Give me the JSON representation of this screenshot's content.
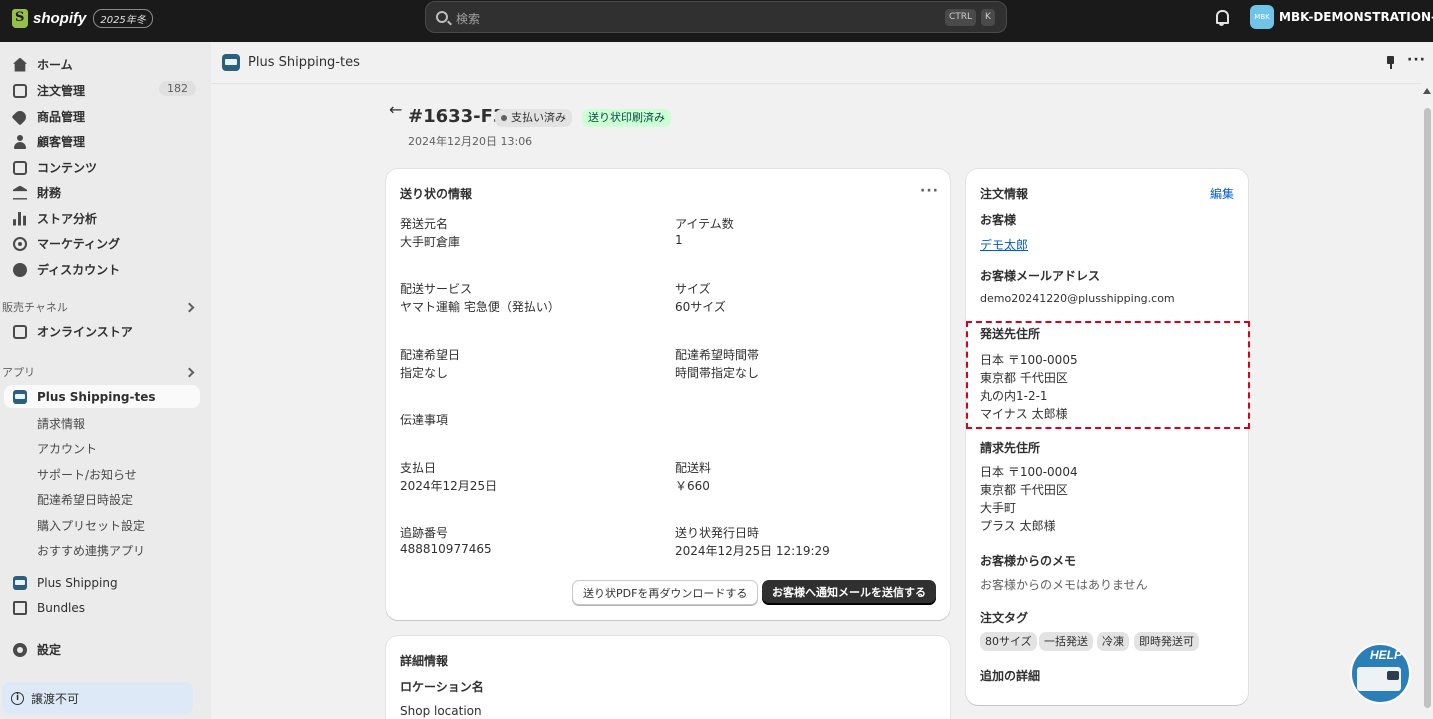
{
  "topbar": {
    "brand": "shopify",
    "edition_badge": "2025年冬",
    "search_placeholder": "検索",
    "shortcut_keys": [
      "CTRL",
      "K"
    ],
    "store_avatar": "MBK",
    "store_name": "MBK-DEMONSTRATION-..."
  },
  "sidebar": {
    "nav": [
      {
        "label": "ホーム",
        "icon": "home-icon"
      },
      {
        "label": "注文管理",
        "icon": "orders-icon",
        "count": "182"
      },
      {
        "label": "商品管理",
        "icon": "tag-icon"
      },
      {
        "label": "顧客管理",
        "icon": "person-icon"
      },
      {
        "label": "コンテンツ",
        "icon": "content-icon"
      },
      {
        "label": "財務",
        "icon": "bank-icon"
      },
      {
        "label": "ストア分析",
        "icon": "bar-chart-icon"
      },
      {
        "label": "マーケティング",
        "icon": "target-icon"
      },
      {
        "label": "ディスカウント",
        "icon": "discount-icon"
      }
    ],
    "sales_channels_header": "販売チャネル",
    "online_store": "オンラインストア",
    "apps_header": "アプリ",
    "active_app": "Plus Shipping-tes",
    "app_subitems": [
      "請求情報",
      "アカウント",
      "サポート/お知らせ",
      "配達希望日時設定",
      "購入プリセット設定",
      "おすすめ連携アプリ"
    ],
    "other_apps": [
      "Plus Shipping",
      "Bundles"
    ],
    "settings": "設定",
    "non_transferable": "譲渡不可"
  },
  "app_header": {
    "title": "Plus Shipping-tes"
  },
  "order": {
    "number": "#1633-F3",
    "payment_badge": "支払い済み",
    "label_badge": "送り状印刷済み",
    "date": "2024年12月20日 13:06"
  },
  "invoice_card": {
    "title": "送り状の情報",
    "fields": {
      "origin_label": "発送元名",
      "origin_value": "大手町倉庫",
      "items_label": "アイテム数",
      "items_value": "1",
      "service_label": "配送サービス",
      "service_value": "ヤマト運輸 宅急便（発払い）",
      "size_label": "サイズ",
      "size_value": "60サイズ",
      "date_label": "配達希望日",
      "date_value": "指定なし",
      "time_label": "配達希望時間帯",
      "time_value": "時間帯指定なし",
      "notes_label": "伝達事項",
      "paydate_label": "支払日",
      "paydate_value": "2024年12月25日",
      "fee_label": "配送料",
      "fee_value": "￥660",
      "tracking_label": "追跡番号",
      "tracking_value": "488810977465",
      "issued_label": "送り状発行日時",
      "issued_value": "2024年12月25日 12:19:29"
    },
    "redownload_button": "送り状PDFを再ダウンロードする",
    "notify_button": "お客様へ通知メールを送信する"
  },
  "details_card": {
    "title": "詳細情報",
    "location_label": "ロケーション名",
    "location_value": "Shop location"
  },
  "order_info": {
    "title": "注文情報",
    "edit": "編集",
    "customer_label": "お客様",
    "customer_name": "デモ太郎",
    "email_label": "お客様メールアドレス",
    "email": "demo20241220@plusshipping.com",
    "shipping_label": "発送先住所",
    "shipping_lines": [
      "日本 〒100-0005",
      "東京都 千代田区",
      "丸の内1-2-1",
      "マイナス 太郎様"
    ],
    "billing_label": "請求先住所",
    "billing_lines": [
      "日本 〒100-0004",
      "東京都 千代田区",
      "大手町",
      "プラス 太郎様"
    ],
    "memo_label": "お客様からのメモ",
    "memo_value": "お客様からのメモはありません",
    "tags_label": "注文タグ",
    "tags": [
      "80サイズ",
      "一括発送",
      "冷凍",
      "即時発送可"
    ],
    "extra_label": "追加の詳細"
  },
  "help_widget": {
    "label": "HELP"
  },
  "colors": {
    "topbar": "#1a1a1a",
    "link": "#005bd3",
    "highlight": "#d9001b",
    "primary_button": "#303030",
    "success_badge": "#cdfed4"
  }
}
